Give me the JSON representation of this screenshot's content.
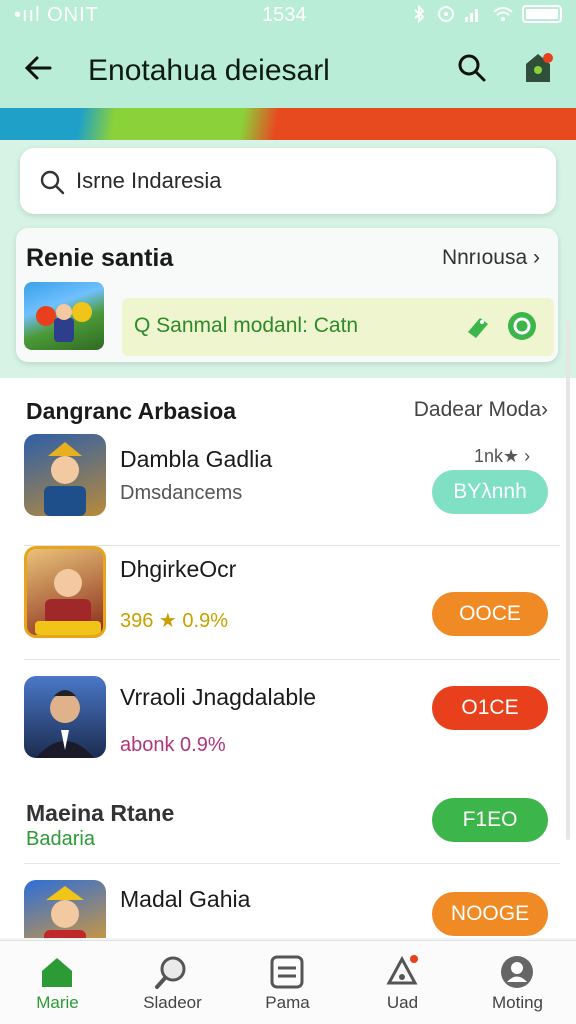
{
  "status": {
    "carrier": "•ııl ONIT",
    "time": "1534"
  },
  "header": {
    "title": "Enotahua  deiesarl"
  },
  "search": {
    "placeholder": "Isrne Indaresia"
  },
  "featured": {
    "title": "Renie santia",
    "link": "Nnrıousa ›",
    "promo": "Q Sanmal modanl: Catn"
  },
  "section": {
    "title": "Dangranc Arbasioa",
    "link": "Dadear Moda›"
  },
  "apps": [
    {
      "name": "Dambla Gadlia",
      "sub": "Dmsdancems",
      "meta": "1nk★  ›",
      "button": "BYλnnh",
      "button_color": "#7fe0c4",
      "sub_color": "#555555"
    },
    {
      "name": "DhgirkeOcr",
      "sub": "396 ★ 0.9%",
      "button": "OOCE",
      "button_color": "#f08a24",
      "sub_color": "#c9a000"
    },
    {
      "name": "Vrraoli Jnagdalable",
      "sub": "abonk 0.9%",
      "button": "O1CE",
      "button_color": "#e8401c",
      "sub_color": "#b0357a"
    },
    {
      "name": "Maeina Rtane",
      "sub": "Badaria",
      "button": "F1EO",
      "button_color": "#3cb54a",
      "sub_color": "#2c9b35"
    },
    {
      "name": "Madal Gahia",
      "sub": "",
      "button": "NOOGE",
      "button_color": "#f08a24",
      "sub_color": "#555555"
    }
  ],
  "nav": [
    {
      "label": "Marie",
      "icon": "home-icon"
    },
    {
      "label": "Sladeor",
      "icon": "search-icon"
    },
    {
      "label": "Pama",
      "icon": "list-icon"
    },
    {
      "label": "Uad",
      "icon": "bell-icon"
    },
    {
      "label": "Moting",
      "icon": "profile-icon"
    }
  ],
  "colors": {
    "header_bg": "#b9edd8",
    "accent": "#2c9b35"
  }
}
